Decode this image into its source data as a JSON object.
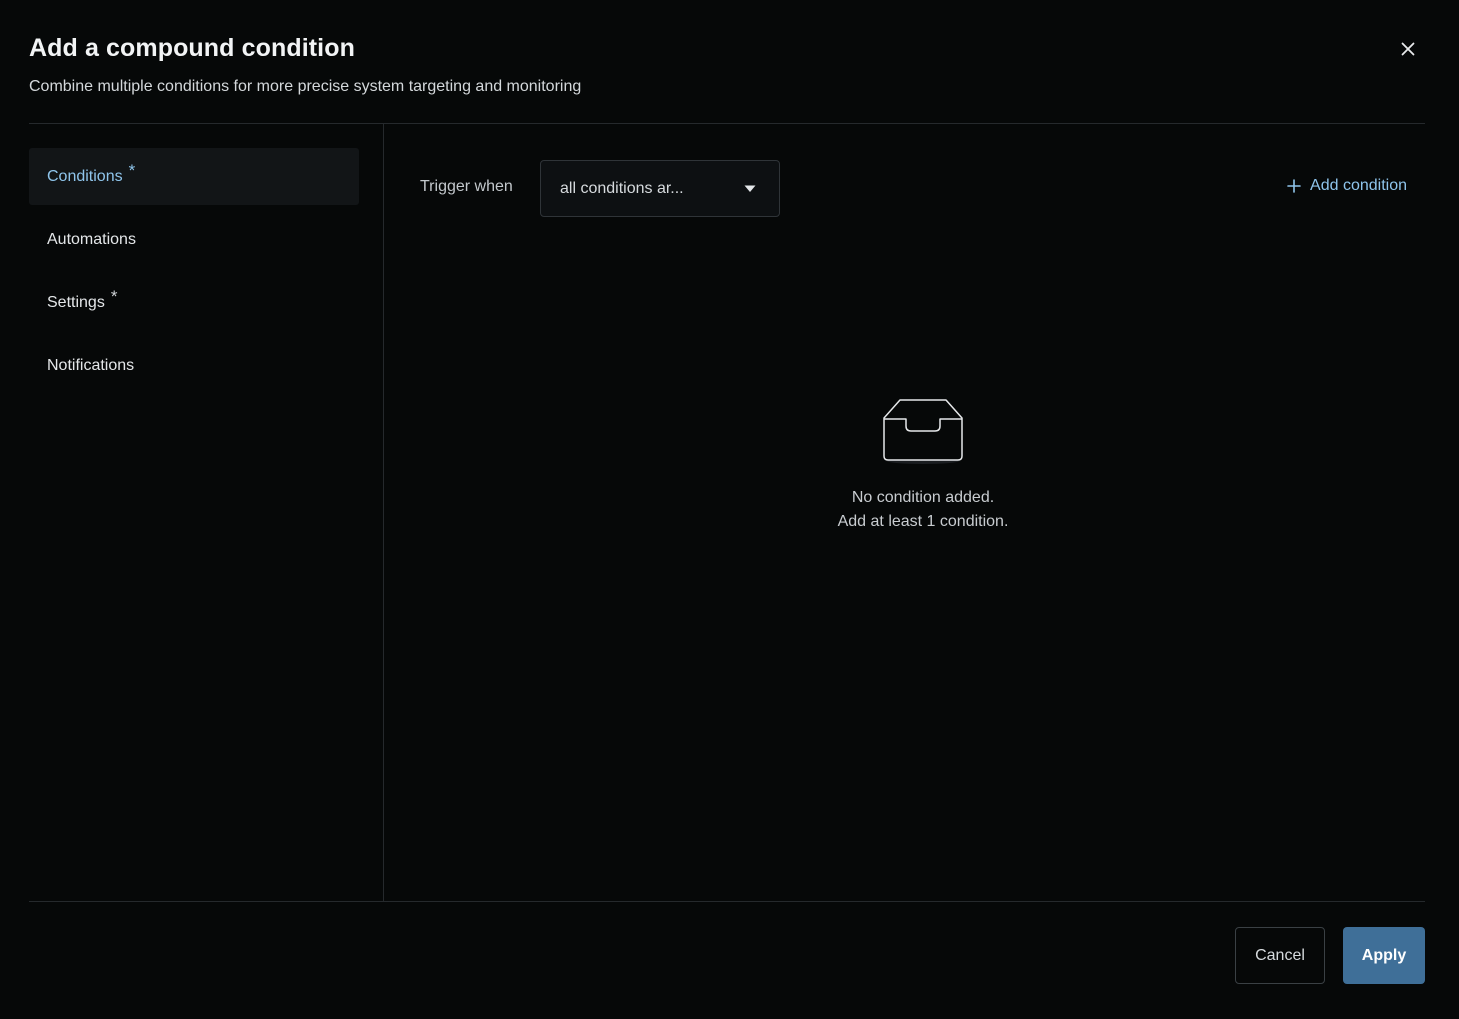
{
  "dialog": {
    "title": "Add a compound condition",
    "subtitle": "Combine multiple conditions for more precise system targeting and monitoring"
  },
  "sidebar": {
    "items": [
      {
        "label": "Conditions",
        "required": "*",
        "active": true
      },
      {
        "label": "Automations",
        "required": "",
        "active": false
      },
      {
        "label": "Settings",
        "required": "*",
        "active": false
      },
      {
        "label": "Notifications",
        "required": "",
        "active": false
      }
    ]
  },
  "main": {
    "trigger_label": "Trigger when",
    "trigger_select_value": "all conditions ar...",
    "add_condition_label": "Add condition",
    "empty_state": {
      "icon": "inbox-icon",
      "line1": "No condition added.",
      "line2": "Add at least 1 condition."
    }
  },
  "footer": {
    "cancel_label": "Cancel",
    "apply_label": "Apply"
  },
  "colors": {
    "background": "#060808",
    "accent": "#8fc5ec",
    "primary_button": "#3f6f98",
    "divider": "#25292c"
  }
}
